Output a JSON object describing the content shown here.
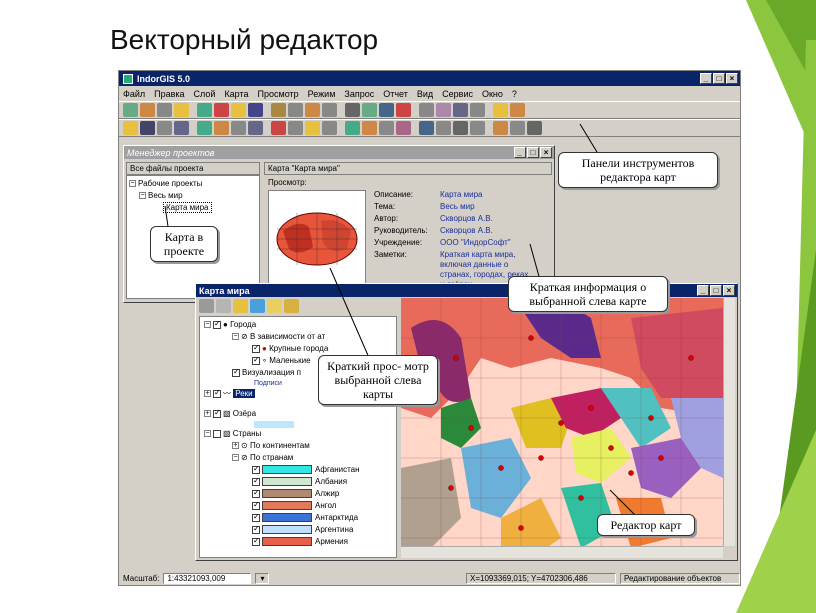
{
  "slide": {
    "title": "Векторный редактор"
  },
  "app": {
    "title": "IndorGIS 5.0",
    "menu": [
      "Файл",
      "Правка",
      "Слой",
      "Карта",
      "Просмотр",
      "Режим",
      "Запрос",
      "Отчет",
      "Вид",
      "Сервис",
      "Окно",
      "?"
    ]
  },
  "project_manager": {
    "title": "Менеджер проектов",
    "left_header": "Все файлы проекта",
    "tree": [
      "Рабочие проекты",
      "Весь мир",
      "Карта мира"
    ],
    "right_header": "Карта \"Карта мира\"",
    "preview_label": "Просмотр:",
    "fields": [
      {
        "key": "Описание:",
        "value": "Карта мира"
      },
      {
        "key": "Тема:",
        "value": "Весь мир"
      },
      {
        "key": "Автор:",
        "value": "Скворцов А.В."
      },
      {
        "key": "Руководитель:",
        "value": "Скворцов А.В."
      },
      {
        "key": "Учреждение:",
        "value": "ООО \"ИндорСофт\""
      },
      {
        "key": "Заметки:",
        "value": "Краткая карта мира, включая данные о странах, городах, реках и озёрах."
      }
    ]
  },
  "map_window": {
    "title": "Карта мира",
    "layers": {
      "cities": "Города",
      "dep": "В зависимости от ат",
      "big": "Крупные города",
      "small": "Маленькие",
      "vis": "Визуализация п",
      "sign": "Подписи",
      "rivers": "Реки",
      "lakes": "Озёра",
      "countries": "Страны",
      "by_cont": "По континентам",
      "by_country": "По странам"
    },
    "countries": [
      {
        "name": "Афганистан",
        "color": "#33e6e6"
      },
      {
        "name": "Албания",
        "color": "#cfe8cf"
      },
      {
        "name": "Алжир",
        "color": "#b08a70"
      },
      {
        "name": "Ангол",
        "color": "#e07a5a"
      },
      {
        "name": "Антарктида",
        "color": "#3a72d8"
      },
      {
        "name": "Аргентина",
        "color": "#c0e0ff"
      },
      {
        "name": "Армения",
        "color": "#e8604a"
      }
    ]
  },
  "status": {
    "scale_label": "Масштаб:",
    "scale_value": "1:43321093,009",
    "coords": "X=1093369,015; Y=4702306,486",
    "mode": "Редактирование объектов"
  },
  "callouts": {
    "toolbar": "Панели инструментов редактора карт",
    "in_project": "Карта в проекте",
    "info": "Краткая информация о выбранной слева карте",
    "preview": "Краткий прос- мотр выбранной слева карты",
    "editor": "Редактор карт"
  }
}
